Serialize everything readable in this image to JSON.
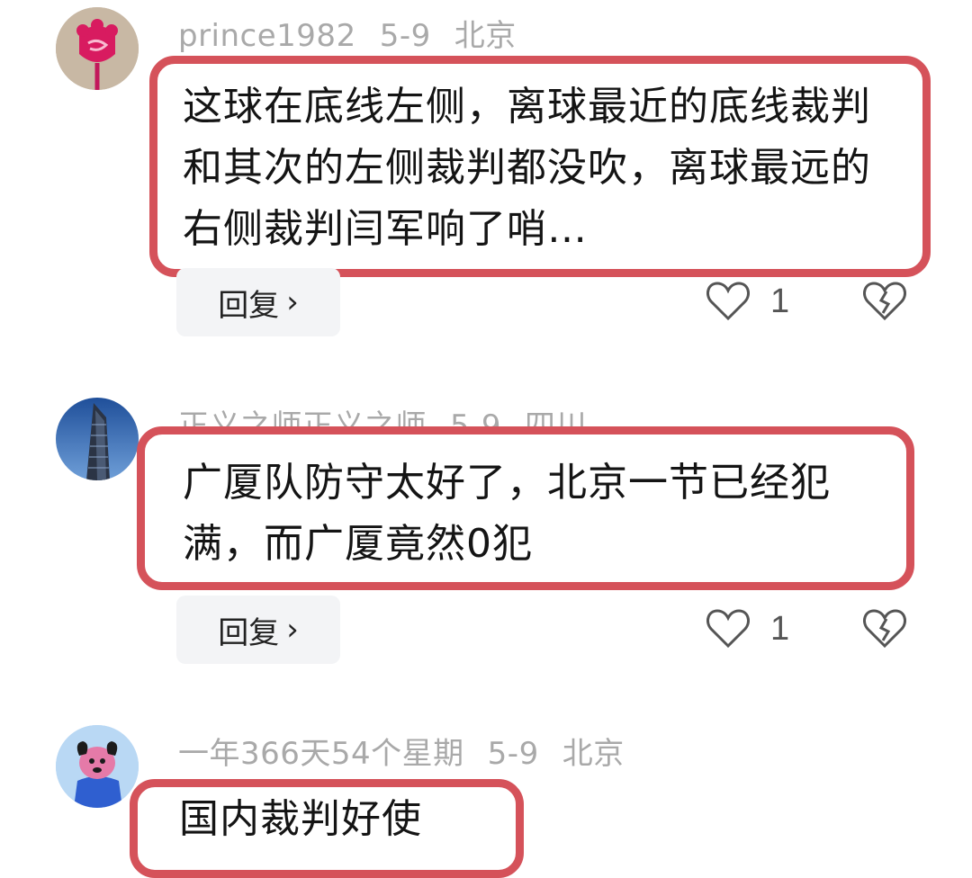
{
  "comments": [
    {
      "username": "prince1982",
      "date": "5-9",
      "location": "北京",
      "text": "这球在底线左侧，离球最近的底线裁判和其次的左侧裁判都没吹，离球最远的右侧裁判闫军响了哨…",
      "reply_label": "回复",
      "reply_chevron": "›",
      "likes": "1",
      "avatar_icon": "rose-avatar-icon"
    },
    {
      "username": "正义之师正义之师",
      "date": "5-9",
      "location": "四川",
      "text": "广厦队防守太好了，北京一节已经犯满，而广厦竟然0犯",
      "reply_label": "回复",
      "reply_chevron": "›",
      "likes": "1",
      "avatar_icon": "skyscraper-avatar-icon"
    },
    {
      "username": "一年366天54个星期",
      "date": "5-9",
      "location": "北京",
      "text": "国内裁判好使",
      "avatar_icon": "cartoon-dog-avatar-icon"
    }
  ],
  "colors": {
    "highlight_border": "#d5525a",
    "meta_text": "#a9a9a9",
    "reply_bg": "#f3f4f6"
  }
}
